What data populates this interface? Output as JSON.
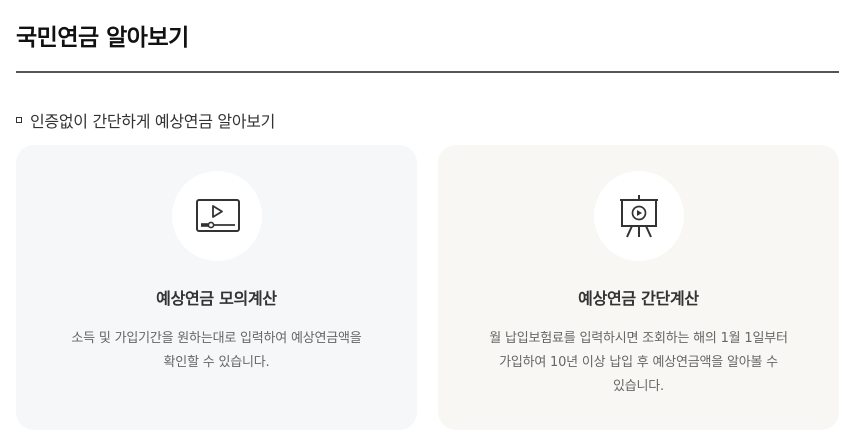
{
  "page": {
    "title": "국민연금 알아보기"
  },
  "section": {
    "heading": "인증없이 간단하게 예상연금 알아보기"
  },
  "cards": [
    {
      "icon": "video-player-icon",
      "title": "예상연금 모의계산",
      "description_lines": [
        "소득 및 가입기간을 원하는대로 입력하여 예상연금액을",
        "확인할 수 있습니다."
      ]
    },
    {
      "icon": "presentation-board-icon",
      "title": "예상연금 간단계산",
      "description_lines": [
        "월 납입보험료를 입력하시면 조회하는 해의 1월 1일부터",
        "가입하여 10년 이상 납입 후 예상연금액을 알아볼 수",
        "있습니다."
      ]
    }
  ],
  "colors": {
    "title_rule": "#555555",
    "card_left_bg": "#f6f7f9",
    "card_right_bg": "#f8f7f4",
    "icon_stroke": "#333333"
  }
}
